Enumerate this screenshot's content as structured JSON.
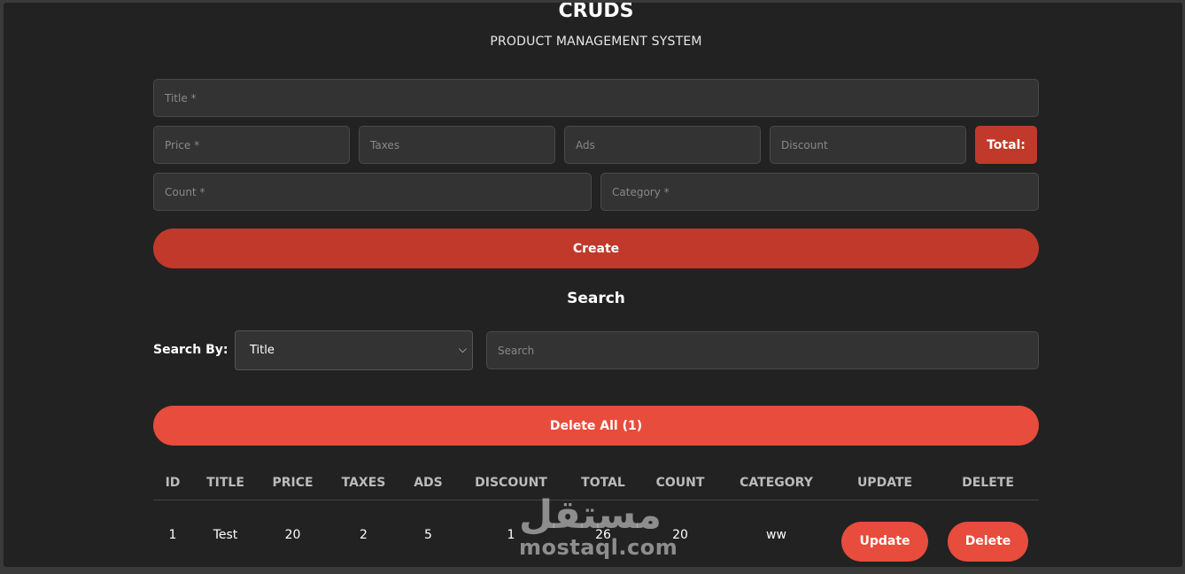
{
  "header": {
    "title": "CRUDS",
    "subtitle": "PRODUCT MANAGEMENT SYSTEM"
  },
  "form": {
    "title_placeholder": "Title *",
    "price_placeholder": "Price *",
    "taxes_placeholder": "Taxes",
    "ads_placeholder": "Ads",
    "discount_placeholder": "Discount",
    "total_label": "Total:",
    "count_placeholder": "Count *",
    "category_placeholder": "Category *",
    "create_label": "Create"
  },
  "search": {
    "heading": "Search",
    "by_label": "Search By:",
    "selected_option": "Title",
    "placeholder": "Search"
  },
  "delete_all_label": "Delete All (1)",
  "table": {
    "headers": [
      "ID",
      "TITLE",
      "PRICE",
      "TAXES",
      "ADS",
      "DISCOUNT",
      "TOTAL",
      "COUNT",
      "CATEGORY",
      "UPDATE",
      "DELETE"
    ],
    "rows": [
      {
        "id": "1",
        "title": "Test",
        "price": "20",
        "taxes": "2",
        "ads": "5",
        "discount": "1",
        "total": "26",
        "count": "20",
        "category": "ww",
        "update_label": "Update",
        "delete_label": "Delete"
      }
    ]
  },
  "watermark": {
    "arabic": "مستقل",
    "latin": "mostaql.com"
  },
  "colors": {
    "background": "#222222",
    "accent": "#c0392b",
    "accent_light": "#e74c3c",
    "input_bg": "#333333"
  }
}
